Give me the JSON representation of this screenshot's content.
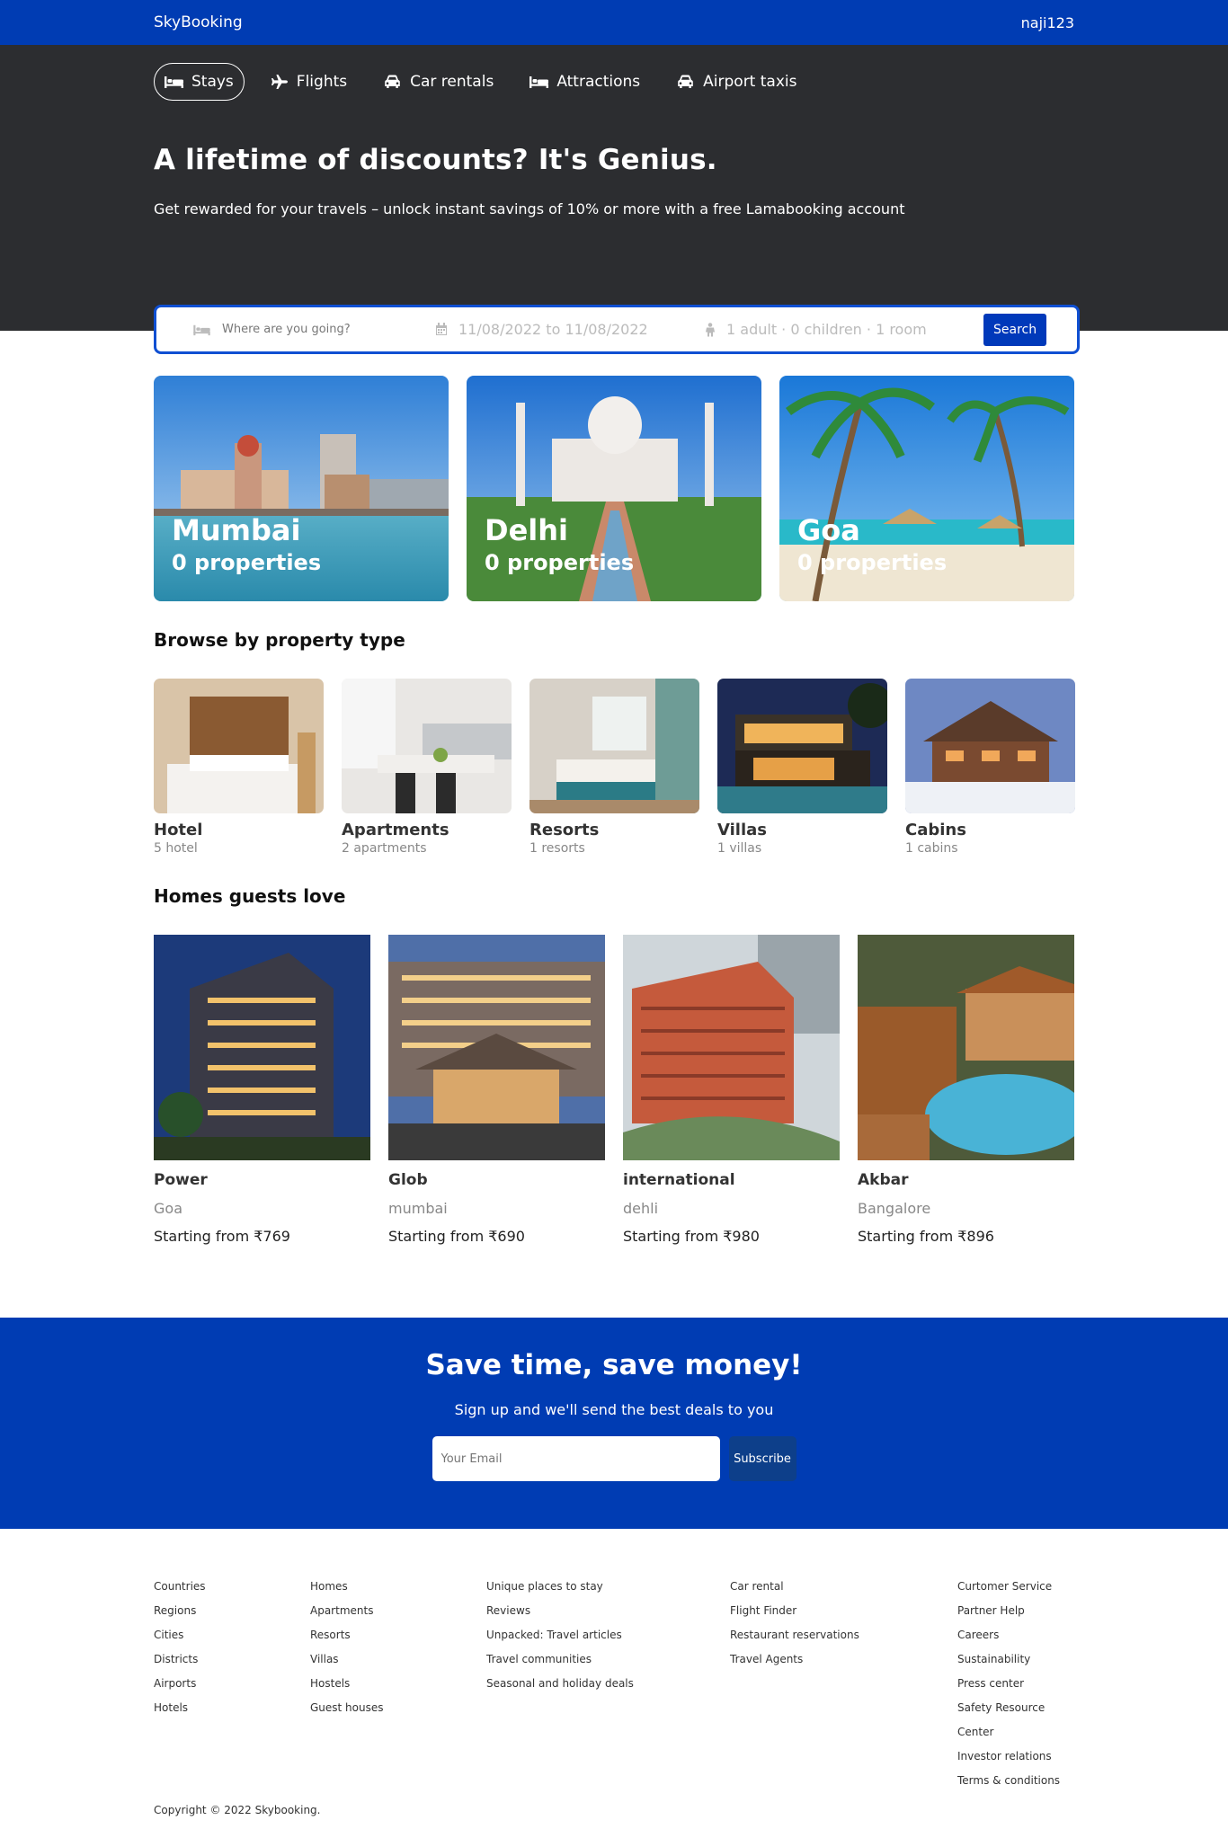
{
  "header": {
    "logo": "SkyBooking",
    "user": "naji123"
  },
  "nav": [
    {
      "label": "Stays",
      "icon": "bed-icon",
      "active": true
    },
    {
      "label": "Flights",
      "icon": "plane-icon"
    },
    {
      "label": "Car rentals",
      "icon": "car-icon"
    },
    {
      "label": "Attractions",
      "icon": "bed-icon"
    },
    {
      "label": "Airport taxis",
      "icon": "taxi-icon"
    }
  ],
  "hero": {
    "title": "A lifetime of discounts? It's Genius.",
    "subtitle": "Get rewarded for your travels – unlock instant savings of 10% or more with a free Lamabooking account"
  },
  "search": {
    "destination_placeholder": "Where are you going?",
    "dates": "11/08/2022 to 11/08/2022",
    "guests": "1 adult · 0 children · 1 room",
    "button": "Search"
  },
  "featured": [
    {
      "city": "Mumbai",
      "properties": "0 properties"
    },
    {
      "city": "Delhi",
      "properties": "0 properties"
    },
    {
      "city": "Goa",
      "properties": "0 properties"
    }
  ],
  "sections": {
    "property_types": "Browse by property type",
    "homes": "Homes guests love"
  },
  "property_types": [
    {
      "title": "Hotel",
      "count": "5 hotel"
    },
    {
      "title": "Apartments",
      "count": "2 apartments"
    },
    {
      "title": "Resorts",
      "count": "1 resorts"
    },
    {
      "title": "Villas",
      "count": "1 villas"
    },
    {
      "title": "Cabins",
      "count": "1 cabins"
    }
  ],
  "homes": [
    {
      "name": "Power",
      "city": "Goa",
      "price": "Starting from ₹769"
    },
    {
      "name": "Glob",
      "city": "mumbai",
      "price": "Starting from ₹690"
    },
    {
      "name": "international",
      "city": "dehli",
      "price": "Starting from ₹980"
    },
    {
      "name": "Akbar",
      "city": "Bangalore",
      "price": "Starting from ₹896"
    }
  ],
  "mail": {
    "title": "Save time, save money!",
    "subtitle": "Sign up and we'll send the best deals to you",
    "placeholder": "Your Email",
    "button": "Subscribe"
  },
  "footer": {
    "columns": [
      [
        "Countries",
        "Regions",
        "Cities",
        "Districts",
        "Airports",
        "Hotels"
      ],
      [
        "Homes",
        "Apartments",
        "Resorts",
        "Villas",
        "Hostels",
        "Guest houses"
      ],
      [
        "Unique places to stay",
        "Reviews",
        "Unpacked: Travel articles",
        "Travel communities",
        "Seasonal and holiday deals"
      ],
      [
        "Car rental",
        "Flight Finder",
        "Restaurant reservations",
        "Travel Agents"
      ],
      [
        "Curtomer Service",
        "Partner Help",
        "Careers",
        "Sustainability",
        "Press center",
        "Safety Resource Center",
        "Investor relations",
        "Terms & conditions"
      ]
    ],
    "copyright": "Copyright © 2022 Skybooking."
  },
  "colors": {
    "brand": "#003cb3",
    "hero_bg": "#2c2d30",
    "search_border": "#0f4fd2"
  }
}
